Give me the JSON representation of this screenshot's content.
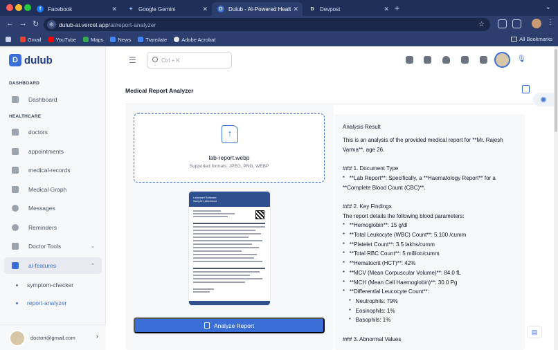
{
  "browser": {
    "tabs": [
      {
        "label": "Facebook",
        "favicon": "facebook-icon",
        "color": "#1877f2",
        "active": false
      },
      {
        "label": "Google Gemini",
        "favicon": "gemini-icon",
        "color": "#8ab4f8",
        "active": false
      },
      {
        "label": "Dulub - AI-Powered Healt",
        "favicon": "dulub-icon",
        "color": "#3b6fd8",
        "active": true
      },
      {
        "label": "Devpost",
        "favicon": "devpost-icon",
        "color": "#1a2748",
        "active": false
      }
    ],
    "url_host": "dulub-ai.vercel.app",
    "url_path": "/ai/report-analyzer",
    "bookmarks": [
      "Gmail",
      "YouTube",
      "Maps",
      "News",
      "Translate",
      "Adobe Acrobat"
    ],
    "all_bookmarks": "All Bookmarks"
  },
  "app": {
    "logo_letter": "D",
    "logo_text": "dulub",
    "search_placeholder": "Ctrl + K",
    "accent": "#3b6fd8"
  },
  "sidebar": {
    "section_dashboard": "DASHBOARD",
    "section_healthcare": "HEALTHCARE",
    "items": {
      "dashboard": "Dashboard",
      "doctors": "doctors",
      "appointments": "appointments",
      "medical_records": "medical-records",
      "medical_graph": "Medical Graph",
      "messages": "Messages",
      "reminders": "Reminders",
      "doctor_tools": "Doctor Tools",
      "ai_features": "ai-features",
      "symptom_checker": "symptom-checker",
      "report_analyzer": "report-analyzer"
    },
    "user_email": "doctort@gmail.com"
  },
  "main": {
    "page_title": "Medical Report Analyzer",
    "upload": {
      "file_name": "lab-report.webp",
      "formats": "Supported formats: JPEG, PNG, WEBP",
      "report_org": "Labsmart Software",
      "report_sub": "Sample Letterhead"
    },
    "analyze_label": "Analyze Report",
    "result_title": "Analysis Result",
    "result_lines": [
      "This is an analysis of the provided medical report for **Mr. Rajesh",
      "Varma**, age 26.",
      "",
      "### 1. Document Type",
      "*   **Lab Report**: Specifically, a **Haematology Report** for a",
      "**Complete Blood Count (CBC)**.",
      "",
      "### 2. Key Findings",
      "The report details the following blood parameters:",
      "*   **Hemoglobin**: 15 g/dl",
      "*   **Total Leukocyte (WBC) Count**: 5,100 /cumm",
      "*   **Platelet Count**: 3.5 lakhs/cumm",
      "*   **Total RBC Count**: 5 million/cumm",
      "*   **Hematocrit (HCT)**: 42%",
      "*   **MCV (Mean Corpuscular Volume)**: 84.0 fL",
      "*   **MCH (Mean Cell Haemoglobin)**: 30.0 Pg",
      "*   **Differential Leucocyte Count**:",
      "    *   Neutrophils: 79%",
      "    *   Eosinophils: 1%",
      "    *   Basophils: 1%",
      "",
      "### 3. Abnormal Values"
    ]
  }
}
